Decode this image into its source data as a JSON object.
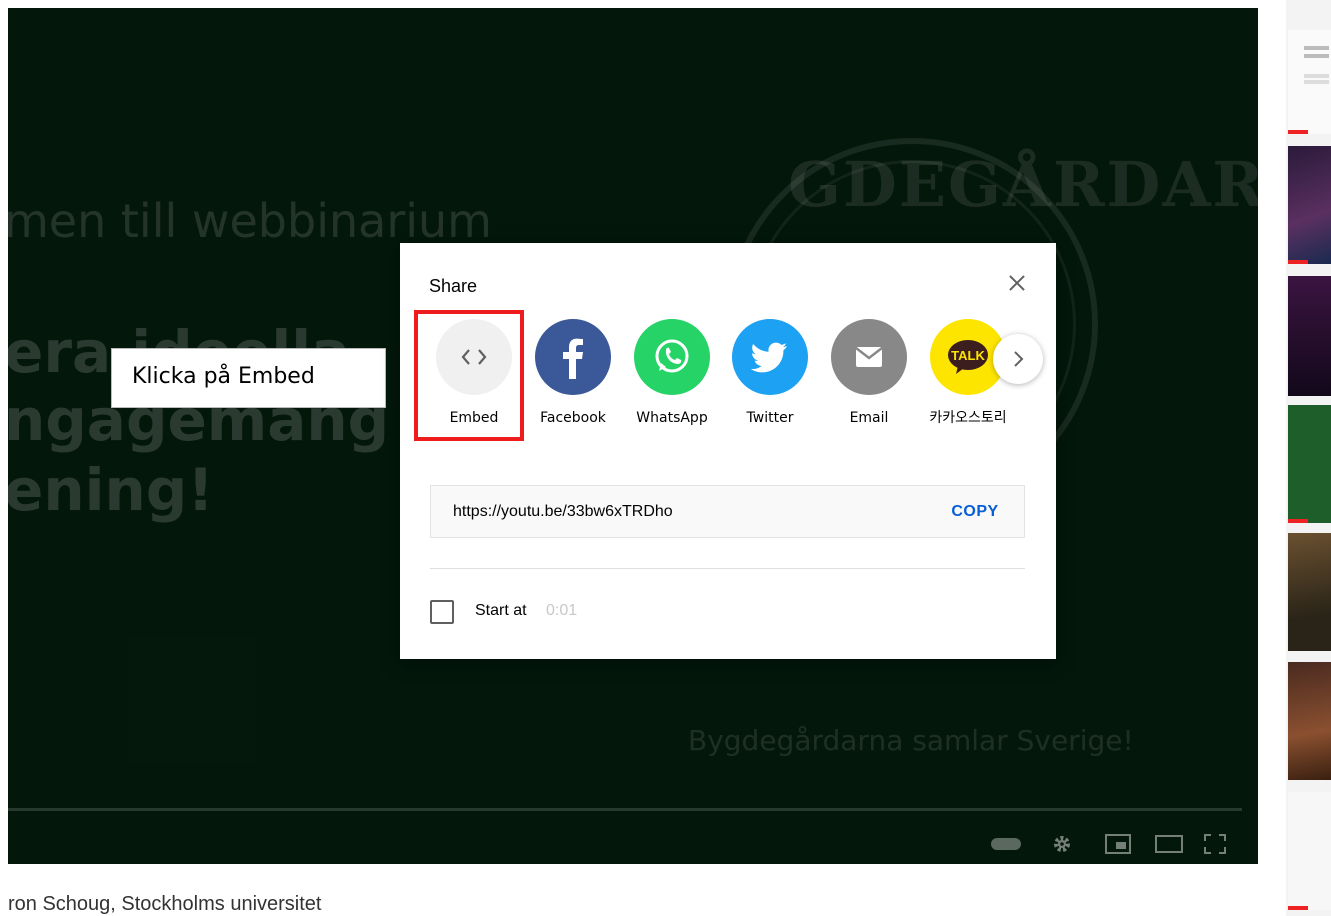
{
  "video": {
    "slide_heading": "men till webbinarium",
    "slide_bold_line1": "era ideella",
    "slide_bold_line2": "ngagemang",
    "slide_bold_line3": "ening!",
    "slide_emblem_text": "GDEGÅRDAR",
    "slide_tagline": "Bygdegårdarna samlar Sverige!",
    "below_title": "ron Schoug, Stockholms universitet"
  },
  "annotation": {
    "text": "Klicka på Embed",
    "highlight_color": "#ee1c1c"
  },
  "share_dialog": {
    "title": "Share",
    "close_icon": "close-icon",
    "targets": [
      {
        "label": "Embed",
        "icon": "embed-code-icon",
        "color": "#f0f0f0"
      },
      {
        "label": "Facebook",
        "icon": "facebook-icon",
        "color": "#3b5998"
      },
      {
        "label": "WhatsApp",
        "icon": "whatsapp-icon",
        "color": "#25d366"
      },
      {
        "label": "Twitter",
        "icon": "twitter-icon",
        "color": "#1da1f2"
      },
      {
        "label": "Email",
        "icon": "email-icon",
        "color": "#888888"
      },
      {
        "label": "카카오스토리",
        "icon": "kakao-talk-icon",
        "color": "#fee500",
        "badge": "TALK"
      }
    ],
    "next_icon": "chevron-right-icon",
    "url": "https://youtu.be/33bw6xTRDho",
    "copy_label": "COPY",
    "copy_color": "#065fd4",
    "start_at_label": "Start at",
    "start_at_time": "0:01"
  },
  "player_controls": {
    "icons": [
      "autoplay-toggle-icon",
      "settings-gear-icon",
      "miniplayer-icon",
      "theater-mode-icon",
      "fullscreen-icon"
    ]
  }
}
